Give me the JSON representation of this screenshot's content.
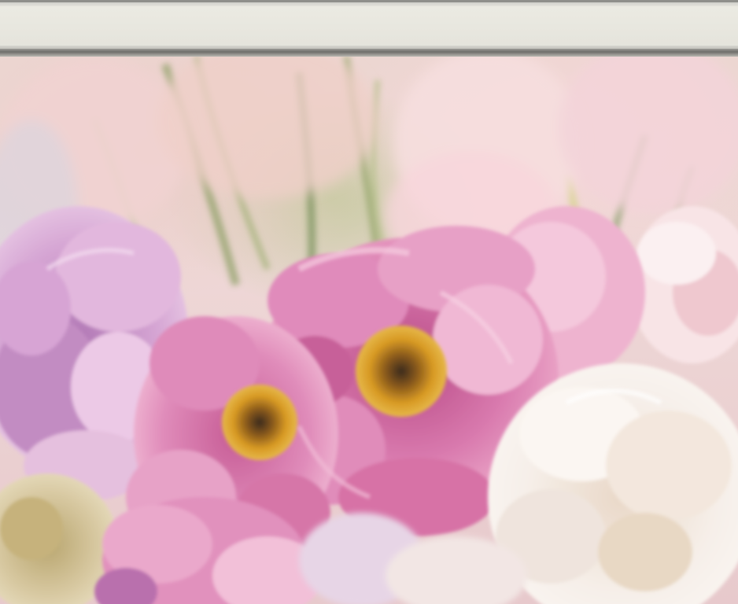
{
  "artwork": {
    "subject": "",
    "palette": {
      "mat": "#e9e7df",
      "frame_dark": "#7a7975",
      "pink_peony": "#d872a6",
      "light_pink": "#f0c6d6",
      "lavender": "#c995c8",
      "white_peony": "#f4ece7",
      "stamen": "#d89a24",
      "grass": "#8fa067",
      "cream_rose": "#d8c9a2"
    }
  }
}
